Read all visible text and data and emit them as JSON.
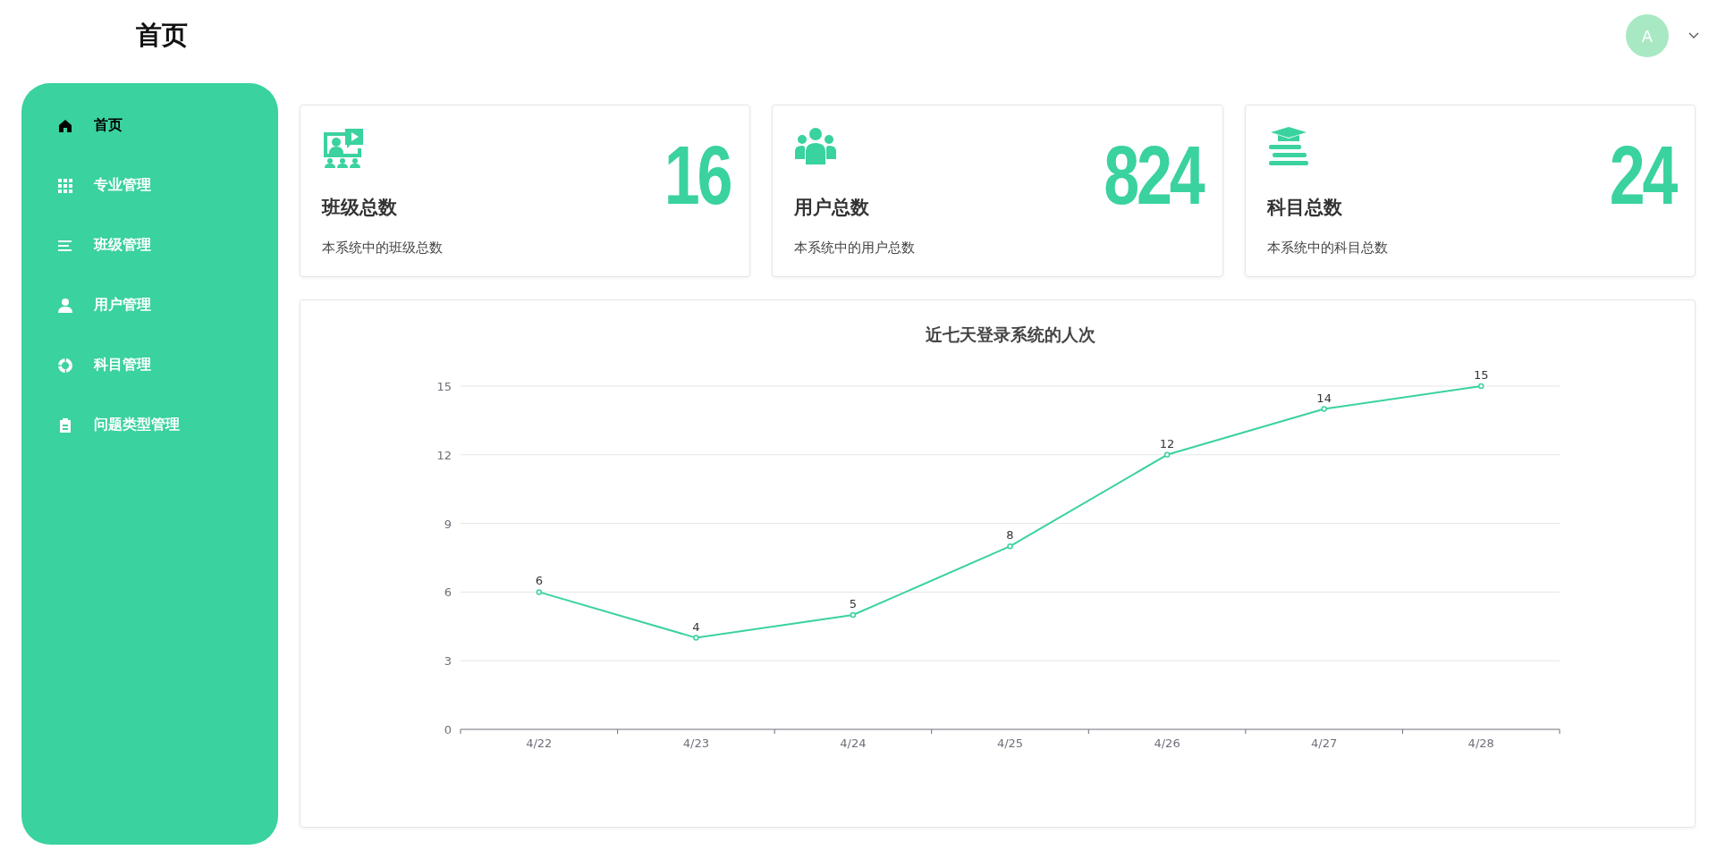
{
  "header": {
    "title": "首页",
    "avatar": {
      "initial": "A"
    }
  },
  "sidebar": {
    "items": [
      {
        "label": "首页",
        "kind": "home",
        "selected": true
      },
      {
        "label": "专业管理",
        "kind": "grid",
        "selected": false
      },
      {
        "label": "班级管理",
        "kind": "list",
        "selected": false
      },
      {
        "label": "用户管理",
        "kind": "user",
        "selected": false
      },
      {
        "label": "科目管理",
        "kind": "ring",
        "selected": false
      },
      {
        "label": "问题类型管理",
        "kind": "clipboard",
        "selected": false
      }
    ]
  },
  "stats": [
    {
      "kind": "classroom",
      "value": "16",
      "title": "班级总数",
      "description": "本系统中的班级总数"
    },
    {
      "kind": "users",
      "value": "824",
      "title": "用户总数",
      "description": "本系统中的用户总数"
    },
    {
      "kind": "books",
      "value": "24",
      "title": "科目总数",
      "description": "本系统中的科目总数"
    }
  ],
  "chart": {
    "chart_data": {
      "type": "line",
      "title": "近七天登录系统的人次",
      "categories": [
        "4/22",
        "4/23",
        "4/24",
        "4/25",
        "4/26",
        "4/27",
        "4/28"
      ],
      "series": [
        {
          "color": "#3ad29f",
          "marker": true,
          "values": [
            6,
            4,
            5,
            8,
            12,
            14,
            15
          ]
        }
      ],
      "ylim": [
        0,
        15
      ],
      "yticks": [
        0,
        3,
        6,
        9,
        12,
        15
      ],
      "grid": true,
      "data_labels": true
    }
  }
}
